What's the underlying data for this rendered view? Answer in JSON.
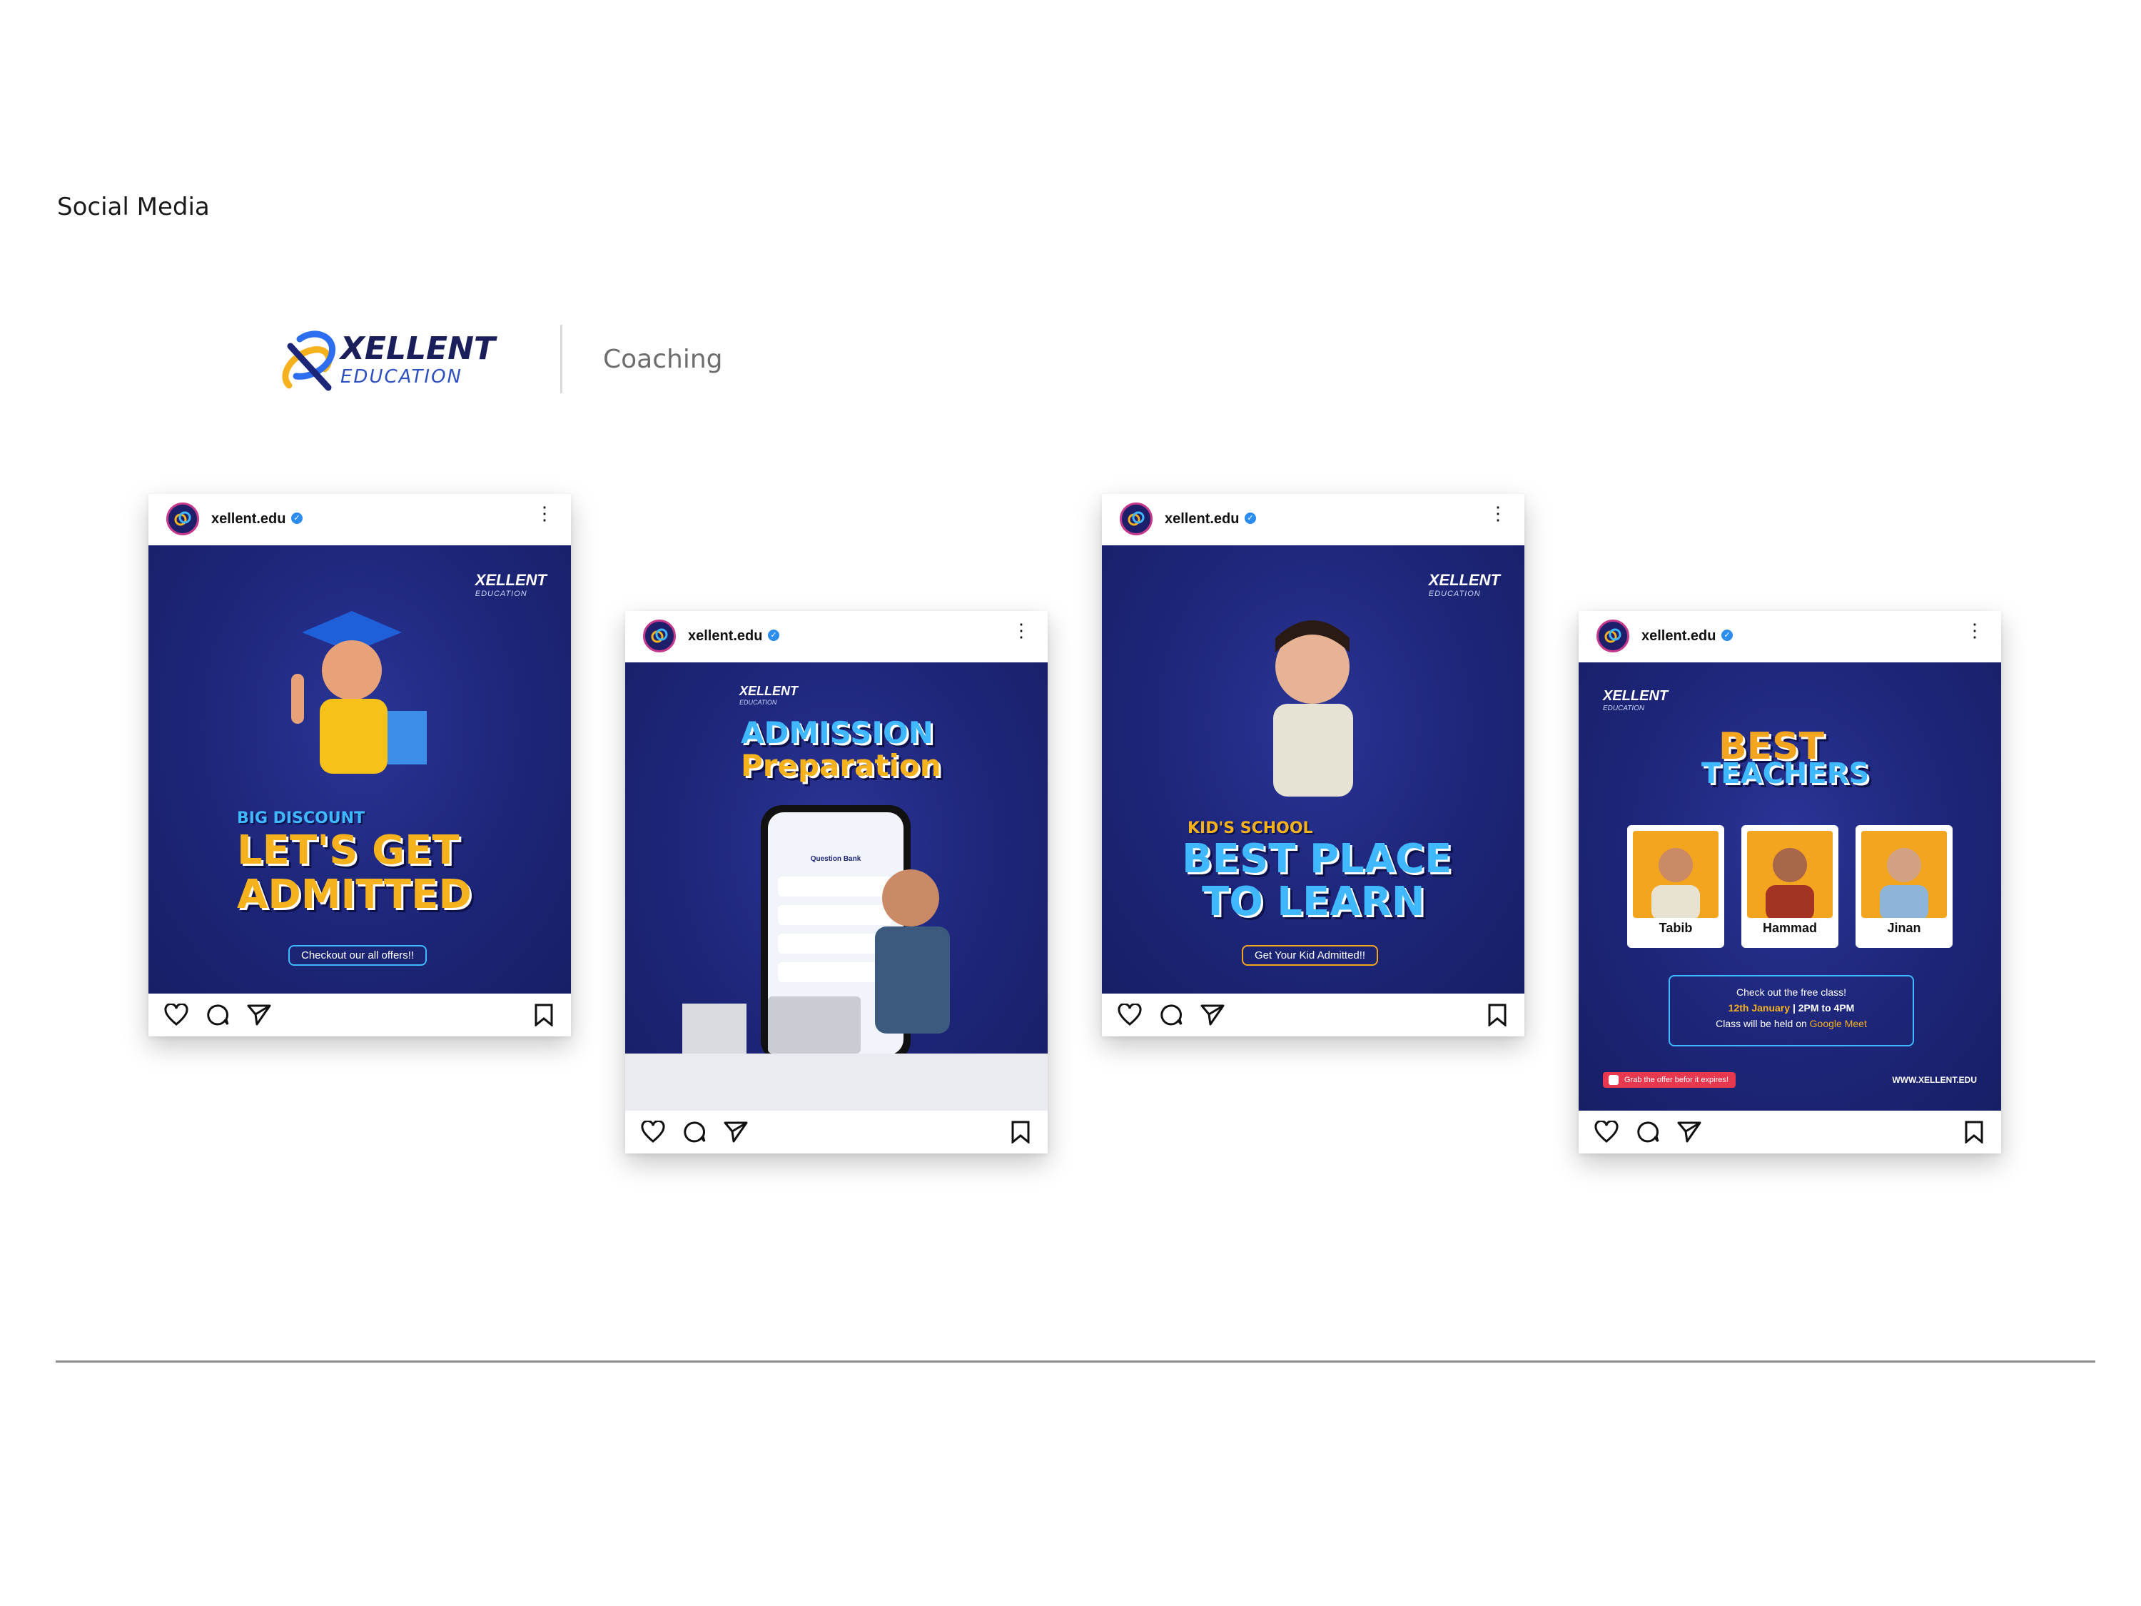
{
  "section_title": "Social Media",
  "brand": {
    "name": "XELLENT",
    "sub": "EDUCATION",
    "tag": "Coaching"
  },
  "posts": [
    {
      "handle": "xellent.edu",
      "logo": "XELLENT",
      "logo_sub": "EDUCATION",
      "kicker": "BIG DISCOUNT",
      "headline": [
        "LET'S GET",
        "ADMITTED"
      ],
      "cta": "Checkout our all offers!!"
    },
    {
      "handle": "xellent.edu",
      "logo": "XELLENT",
      "logo_sub": "EDUCATION",
      "headline": [
        "ADMISSION",
        "Preparation"
      ],
      "phone_title": "Question Bank"
    },
    {
      "handle": "xellent.edu",
      "logo": "XELLENT",
      "logo_sub": "EDUCATION",
      "kicker": "KID'S SCHOOL",
      "headline": [
        "BEST PLACE",
        "TO LEARN"
      ],
      "cta": "Get Your Kid Admitted!!"
    },
    {
      "handle": "xellent.edu",
      "logo": "XELLENT",
      "logo_sub": "EDUCATION",
      "headline": [
        "BEST",
        "TEACHERS"
      ],
      "teachers": [
        {
          "name": "Tabib"
        },
        {
          "name": "Hammad"
        },
        {
          "name": "Jinan"
        }
      ],
      "info": {
        "line1": "Check out the free class!",
        "date": "12th January",
        "time": "2PM to 4PM",
        "line3_prefix": "Class will be held on",
        "platform": "Google Meet"
      },
      "offer": "Grab the offer befor it expires!",
      "website": "WWW.XELLENT.EDU"
    }
  ],
  "icons": {
    "like": "heart-icon",
    "comment": "comment-icon",
    "share": "send-icon",
    "save": "bookmark-icon",
    "more": "more-vertical-icon",
    "verified": "verified-badge-icon"
  },
  "colors": {
    "brand_navy": "#1d2578",
    "brand_yellow": "#f6b21c",
    "brand_cyan": "#3fb8ff",
    "brand_orange": "#f4a51f"
  }
}
